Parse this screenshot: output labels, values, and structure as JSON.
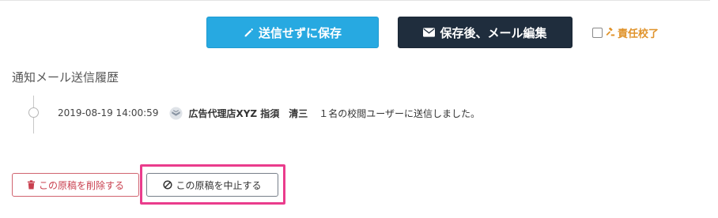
{
  "actions": {
    "save_without_send_label": "送信せずに保存",
    "save_then_edit_mail_label": "保存後、メール編集",
    "responsibility_proof_label": "責任校了"
  },
  "history": {
    "title": "通知メール送信履歴",
    "entries": [
      {
        "timestamp": "2019-08-19 14:00:59",
        "sender": "広告代理店XYZ 指須　清三",
        "message": "１名の校閲ユーザーに送信しました。"
      }
    ]
  },
  "footer": {
    "delete_label": "この原稿を削除する",
    "cancel_label": "この原稿を中止する"
  },
  "colors": {
    "primary": "#27a9e1",
    "dark": "#1f2d3d",
    "accent_orange": "#e0932b",
    "danger": "#c9404f",
    "highlight": "#ea3c8c"
  },
  "icons": {
    "save_button": "pencil-icon",
    "mail_button": "envelope-icon",
    "responsibility": "gavel-icon",
    "sender": "organization-icon",
    "delete_button": "trash-icon",
    "cancel_button": "ban-icon"
  }
}
